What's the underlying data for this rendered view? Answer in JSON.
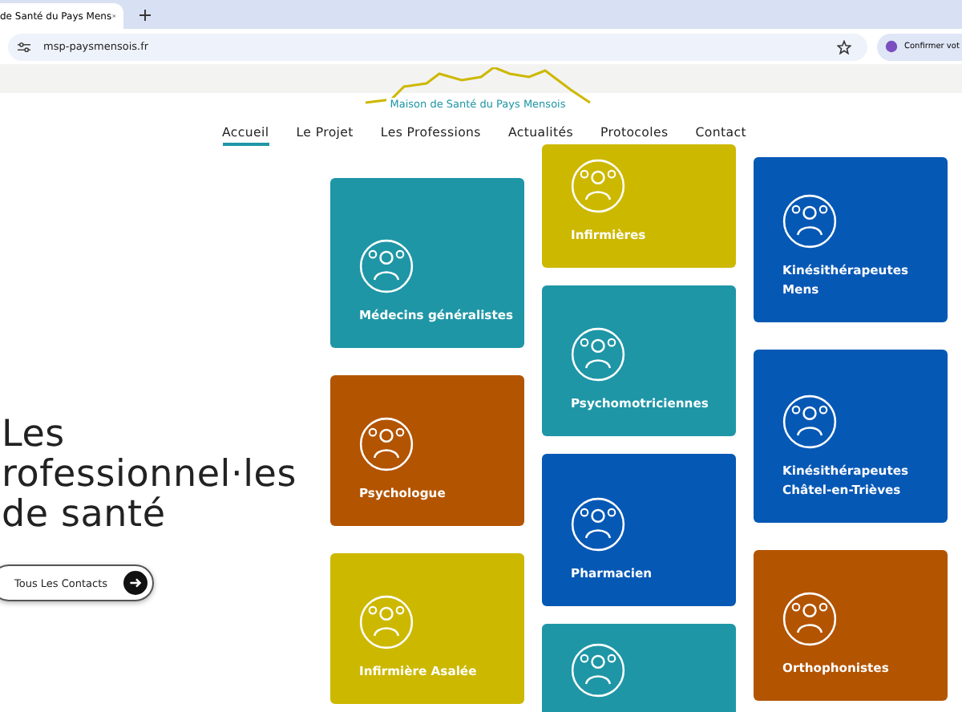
{
  "browser": {
    "tab_title": "de Santé du Pays Mens",
    "url": "msp-paysmensois.fr",
    "extension_label": "Confirmer vot"
  },
  "logo": {
    "text": "Maison de Santé du Pays Mensois"
  },
  "nav": [
    {
      "label": "Accueil",
      "selected": true
    },
    {
      "label": "Le Projet",
      "selected": false
    },
    {
      "label": "Les Professions",
      "selected": false
    },
    {
      "label": "Actualités",
      "selected": false
    },
    {
      "label": "Protocoles",
      "selected": false
    },
    {
      "label": "Contact",
      "selected": false
    }
  ],
  "hero": {
    "heading_lines": [
      "Les",
      "rofessionnel·les",
      "de santé"
    ],
    "button": "Tous Les Contacts"
  },
  "card_columns": [
    [
      {
        "label": "Médecins généralistes",
        "color": "#1e96a6"
      },
      {
        "label": "Psychologue",
        "color": "#b35400"
      },
      {
        "label": "Infirmière Asalée",
        "color": "#cdb800"
      }
    ],
    [
      {
        "label": "Infirmières",
        "color": "#cdb800"
      },
      {
        "label": "Psychomotriciennes",
        "color": "#1e96a6"
      },
      {
        "label": "Pharmacien",
        "color": "#0658b5"
      },
      {
        "color": "#1e96a6"
      }
    ],
    [
      {
        "label": "Kinésithérapeutes Mens",
        "color": "#0658b5"
      },
      {
        "label": "Kinésithérapeutes Châtel-en-Trièves",
        "color": "#0658b5"
      },
      {
        "label": "Orthophonistes",
        "color": "#b35400"
      }
    ]
  ]
}
